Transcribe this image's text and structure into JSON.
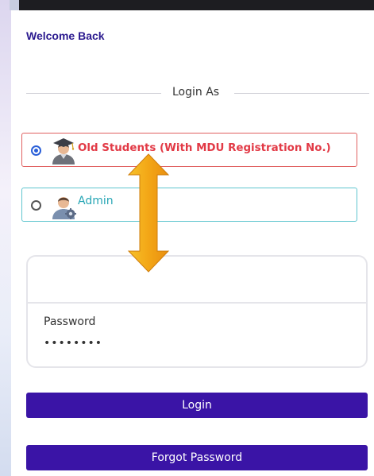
{
  "header": {
    "welcome": "Welcome Back"
  },
  "login_as": {
    "label": "Login As"
  },
  "roles": [
    {
      "label": "Old Students (With MDU Registration No.)",
      "selected": true,
      "icon": "graduate-avatar-icon",
      "color": "#e23a46"
    },
    {
      "label": "Admin",
      "selected": false,
      "icon": "admin-avatar-icon",
      "color": "#27a6b5"
    }
  ],
  "form": {
    "password_label": "Password",
    "password_value": "••••••••"
  },
  "buttons": {
    "login": "Login",
    "forgot_password": "Forgot Password"
  },
  "colors": {
    "primary": "#3a14a6",
    "student_accent": "#e23a46",
    "admin_accent": "#27a6b5",
    "annotation_arrow": "#f5b21a"
  },
  "annotation": {
    "icon": "double-headed-arrow-icon"
  }
}
